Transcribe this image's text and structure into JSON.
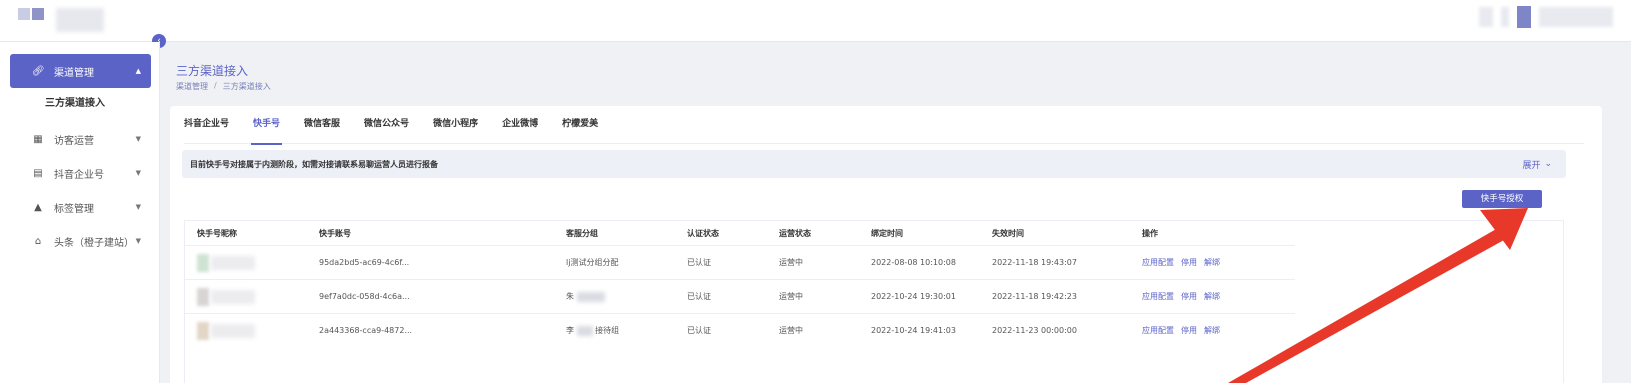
{
  "header": {},
  "sidebar": {
    "items": [
      {
        "label": "渠道管理",
        "icon": "link-icon",
        "active": true
      },
      {
        "label": "访客运营",
        "icon": "chart-icon"
      },
      {
        "label": "抖音企业号",
        "icon": "chat-icon"
      },
      {
        "label": "标签管理",
        "icon": "tag-icon"
      },
      {
        "label": "头条（橙子建站）",
        "icon": "home-icon"
      }
    ],
    "sub_item": "三方渠道接入"
  },
  "page": {
    "title": "三方渠道接入",
    "breadcrumb": [
      "渠道管理",
      "/",
      "三方渠道接入"
    ]
  },
  "tabs": [
    "抖音企业号",
    "快手号",
    "微信客服",
    "微信公众号",
    "微信小程序",
    "企业微博",
    "柠檬爱美"
  ],
  "active_tab": "快手号",
  "notice": {
    "text": "目前快手号对接属于内测阶段，如需对接请联系易聊运营人员进行报备",
    "expand_label": "展开"
  },
  "auth_button": "快手号授权",
  "table": {
    "columns": [
      "快手号昵称",
      "快手账号",
      "客服分组",
      "认证状态",
      "运营状态",
      "绑定时间",
      "失效时间",
      "操作"
    ],
    "rows": [
      {
        "account": "95da2bd5-ac69-4c6f...",
        "group": "lj测试分组分配",
        "auth": "已认证",
        "status": "运营中",
        "bind_time": "2022-08-08 10:10:08",
        "expire_time": "2022-11-18 19:43:07"
      },
      {
        "account": "9ef7a0dc-058d-4c6a...",
        "group": "朱",
        "auth": "已认证",
        "status": "运营中",
        "bind_time": "2022-10-24 19:30:01",
        "expire_time": "2022-11-18 19:42:23"
      },
      {
        "account": "2a443368-cca9-4872...",
        "group": "李",
        "group_suffix": "接待组",
        "auth": "已认证",
        "status": "运营中",
        "bind_time": "2022-10-24 19:41:03",
        "expire_time": "2022-11-23 00:00:00"
      }
    ],
    "actions": [
      "应用配置",
      "停用",
      "解绑"
    ]
  },
  "colors": {
    "accent": "#5b63c7",
    "annotation": "#e8382a"
  }
}
